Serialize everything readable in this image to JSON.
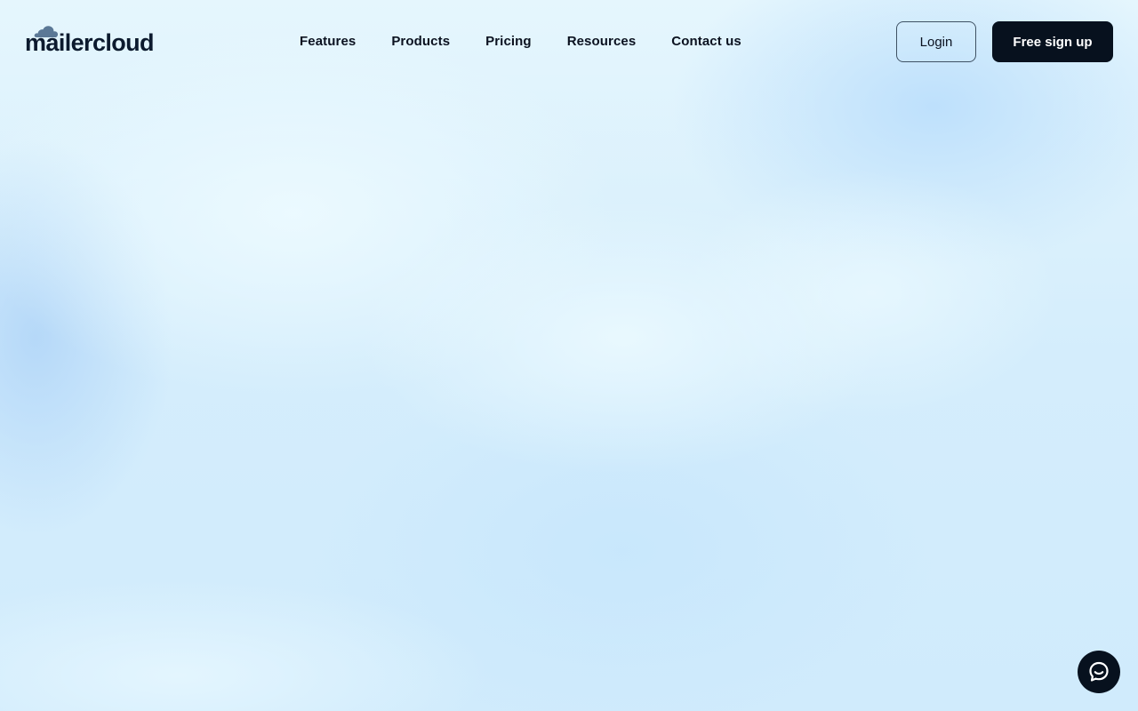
{
  "brand": {
    "name": "mailercloud",
    "logo_icon": "cloud-icon",
    "cloud_color": "#5b7896",
    "text_color": "#0c1a2e"
  },
  "nav": {
    "items": [
      {
        "label": "Features"
      },
      {
        "label": "Products"
      },
      {
        "label": "Pricing"
      },
      {
        "label": "Resources"
      },
      {
        "label": "Contact us"
      }
    ]
  },
  "actions": {
    "login_label": "Login",
    "signup_label": "Free sign up"
  },
  "chat": {
    "icon": "chat-bubble-icon"
  },
  "colors": {
    "primary_dark": "#07111e",
    "background": "#d2ebfc"
  }
}
